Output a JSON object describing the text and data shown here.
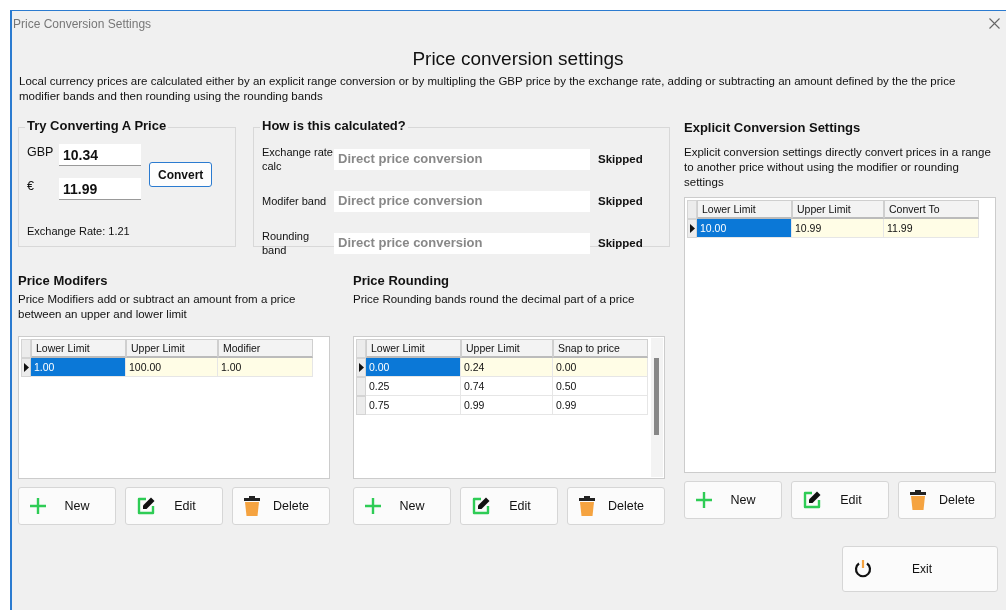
{
  "window": {
    "title": "Price Conversion Settings"
  },
  "heading": "Price conversion settings",
  "description": "Local currency prices are calculated either by an explicit range conversion or by multipling the GBP price by the exchange rate, adding or subtracting an amount defined by the the price modifier bands and then rounding using the rounding bands",
  "try_panel": {
    "title": "Try Converting A Price",
    "fields": [
      {
        "label": "GBP",
        "value": "10.34"
      },
      {
        "label": "€",
        "value": "11.99"
      }
    ],
    "convert_button": "Convert",
    "exchange_rate": "Exchange Rate: 1.21"
  },
  "calculation": {
    "title": "How is this calculated?",
    "steps": [
      {
        "label": "Exchange rate calc",
        "value": "Direct price conversion",
        "status": "Skipped"
      },
      {
        "label": "Modifer band",
        "value": "Direct price conversion",
        "status": "Skipped"
      },
      {
        "label": "Rounding band",
        "value": "Direct price conversion",
        "status": "Skipped"
      }
    ]
  },
  "sections": [
    {
      "title": "Price Modifers",
      "description": "Price Modifiers add or subtract an amount from a price between an upper and lower limit",
      "scrollbar": false,
      "table": {
        "columns": [
          "Lower Limit",
          "Upper Limit",
          "Modifier"
        ],
        "rows": [
          {
            "cells": [
              "1.00",
              "100.00",
              "1.00"
            ],
            "selected": true
          }
        ]
      },
      "buttons": [
        {
          "label": "New",
          "kind": "new"
        },
        {
          "label": "Edit",
          "kind": "edit"
        },
        {
          "label": "Delete",
          "kind": "delete"
        }
      ]
    },
    {
      "title": "Price Rounding",
      "description": "Price Rounding bands round the decimal part of a price",
      "scrollbar": true,
      "table": {
        "columns": [
          "Lower Limit",
          "Upper Limit",
          "Snap to price"
        ],
        "rows": [
          {
            "cells": [
              "0.00",
              "0.24",
              "0.00"
            ],
            "selected": true
          },
          {
            "cells": [
              "0.25",
              "0.74",
              "0.50"
            ],
            "selected": false
          },
          {
            "cells": [
              "0.75",
              "0.99",
              "0.99"
            ],
            "selected": false
          }
        ]
      },
      "buttons": [
        {
          "label": "New",
          "kind": "new"
        },
        {
          "label": "Edit",
          "kind": "edit"
        },
        {
          "label": "Delete",
          "kind": "delete"
        }
      ]
    },
    {
      "title": "Explicit Conversion Settings",
      "description": "Explicit conversion settings directly convert prices in a range to another price without using the modifier or rounding settings",
      "scrollbar": false,
      "table": {
        "columns": [
          "Lower Limit",
          "Upper Limit",
          "Convert To"
        ],
        "rows": [
          {
            "cells": [
              "10.00",
              "10.99",
              "11.99"
            ],
            "selected": true
          }
        ]
      },
      "buttons": [
        {
          "label": "New",
          "kind": "new"
        },
        {
          "label": "Edit",
          "kind": "edit"
        },
        {
          "label": "Delete",
          "kind": "delete"
        }
      ]
    }
  ],
  "exit_button": "Exit"
}
